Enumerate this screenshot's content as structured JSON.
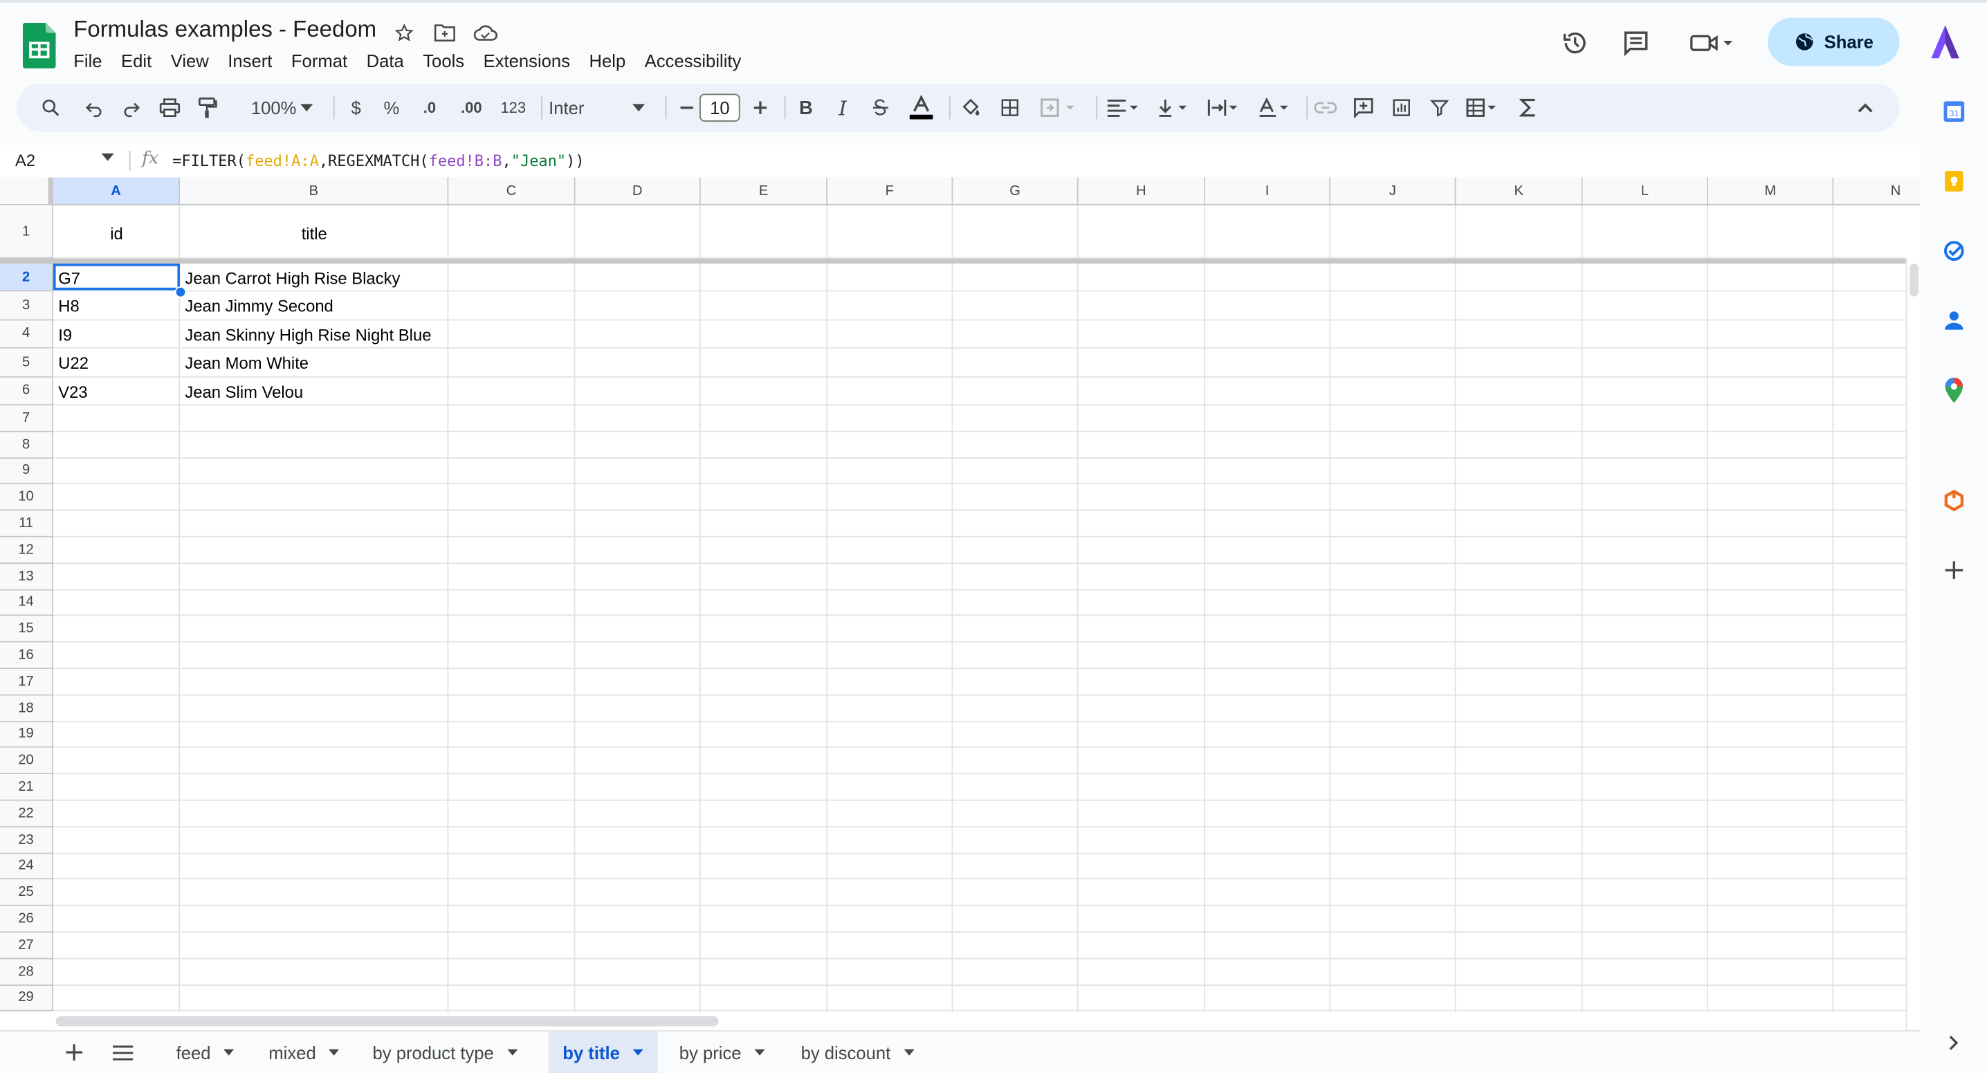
{
  "app": {
    "doc_title": "Formulas examples - Feedom",
    "menu": [
      "File",
      "Edit",
      "View",
      "Insert",
      "Format",
      "Data",
      "Tools",
      "Extensions",
      "Help",
      "Accessibility"
    ],
    "share_label": "Share"
  },
  "toolbar": {
    "zoom": "100%",
    "currency": "$",
    "percent": "%",
    "decimal_decrease": ".0",
    "decimal_increase": ".00",
    "number_format": "123",
    "font": "Inter",
    "font_size": "10",
    "bold": "B",
    "italic": "I"
  },
  "formula_bar": {
    "cell_ref": "A2",
    "fx": "fx",
    "formula_parts": [
      "=FILTER(",
      "feed!A:A",
      ",REGEXMATCH(",
      "feed!B:B",
      ",",
      "\"Jean\"",
      "))"
    ]
  },
  "sheet": {
    "columns": [
      "A",
      "B",
      "C",
      "D",
      "E",
      "F",
      "G",
      "H",
      "I",
      "J",
      "K",
      "L",
      "M",
      "N"
    ],
    "rows": [
      "1",
      "2",
      "3",
      "4",
      "5",
      "6",
      "7",
      "8",
      "9",
      "10",
      "11",
      "12",
      "13",
      "14",
      "15",
      "16",
      "17",
      "18",
      "19",
      "20",
      "21",
      "22",
      "23",
      "24",
      "25",
      "26",
      "27",
      "28",
      "29"
    ],
    "header": {
      "a": "id",
      "b": "title"
    },
    "data": [
      {
        "id": "G7",
        "title": "Jean Carrot High Rise Blacky"
      },
      {
        "id": "H8",
        "title": "Jean Jimmy Second"
      },
      {
        "id": "I9",
        "title": "Jean Skinny High Rise Night Blue"
      },
      {
        "id": "U22",
        "title": "Jean Mom White"
      },
      {
        "id": "V23",
        "title": "Jean Slim Velou"
      }
    ],
    "selected_cell": "A2"
  },
  "tabs": [
    "feed",
    "mixed",
    "by product type",
    "by title",
    "by price",
    "by discount"
  ],
  "active_tab": "by title",
  "colors": {
    "accent": "#0b57d0",
    "share_bg": "#c2e7ff",
    "selection": "#1a73e8",
    "sheets_green": "#0f9d58"
  }
}
